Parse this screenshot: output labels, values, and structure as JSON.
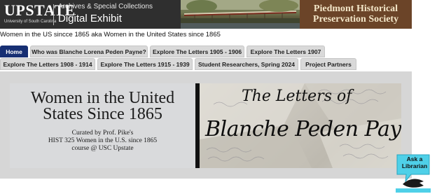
{
  "header": {
    "brand_word": "UPSTATE",
    "brand_sub": "University of South Carolina",
    "archives_label": "Archives & Special Collections",
    "exhibit_label": "Digital Exhibit",
    "society_line1": "Piedmont Historical",
    "society_line2": "Preservation Society"
  },
  "page_title": "Women in the US sincce 1865 aka Women in the United States since 1865",
  "tabs": [
    {
      "label": "Home",
      "active": true
    },
    {
      "label": "Who was Blanche Lorena Peden Payne?"
    },
    {
      "label": "Explore The Letters 1905 - 1906"
    },
    {
      "label": "Explore The Letters 1907"
    },
    {
      "label": "Explore The Letters 1908 - 1914"
    },
    {
      "label": "Explore The Letters 1915 - 1939"
    },
    {
      "label": "Student Researchers, Spring 2024"
    },
    {
      "label": "Project Partners"
    }
  ],
  "banner": {
    "title_line1": "Women in the United",
    "title_line2": "States Since 1865",
    "curated_line1": "Curated by Prof. Pike's",
    "curated_line2": "HIST 325 Women in the U.S. since 1865",
    "curated_line3": "course @ USC Upstate",
    "letters_of": "The Letters of",
    "name": "Blanche Peden Payne"
  },
  "ask_widget": {
    "line1": "Ask a",
    "line2": "Librarian"
  },
  "colors": {
    "active_tab": "#172f73",
    "tab_bg": "#d9d9d9",
    "banner_bg": "#d6d6d6",
    "ask_bg": "#4fd0e8"
  }
}
